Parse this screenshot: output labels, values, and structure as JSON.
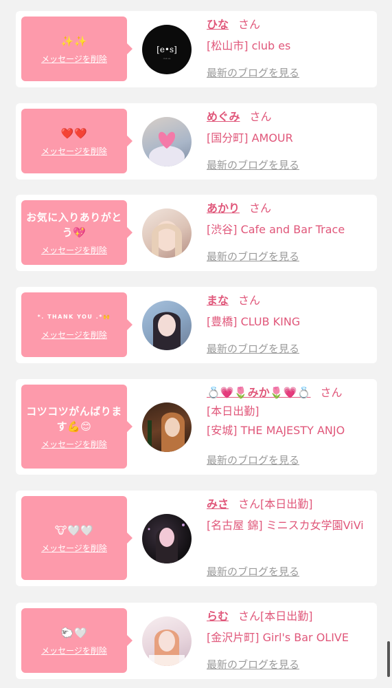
{
  "delete_label": "メッセージを削除",
  "blog_label": "最新のブログを見る",
  "san_label": "さん",
  "cards": [
    {
      "message": "✨✨",
      "name": "ひな",
      "shop": "[松山市] club es",
      "avatar": "es-logo"
    },
    {
      "message": "❤️❤️",
      "name": "めぐみ",
      "shop": "[国分町] AMOUR",
      "avatar": "photo-megumi"
    },
    {
      "message": "お気に入りありがとう💖",
      "name": "あかり",
      "shop": "[渋谷] Cafe and Bar Trace",
      "avatar": "photo-akari"
    },
    {
      "message": "*. THANK YOU .*🙌",
      "name": "まな",
      "shop": "[豊橋] CLUB KING",
      "avatar": "photo-mana"
    },
    {
      "message": "コツコツがんばります💪😊",
      "name": "💍💗🌷みか🌷💗💍",
      "status": "[本日出勤]",
      "shop": "[安城] THE MAJESTY ANJO",
      "avatar": "photo-mika"
    },
    {
      "message": "🐮🤍🤍",
      "name": "みさ",
      "status": "[本日出勤]",
      "shop": "[名古屋 錦] ミニスカ女学園ViVi",
      "avatar": "photo-misa"
    },
    {
      "message": "🐑🤍",
      "name": "らむ",
      "status": "[本日出勤]",
      "shop": "[金沢片町] Girl's Bar OLIVE",
      "avatar": "photo-ramu"
    }
  ]
}
